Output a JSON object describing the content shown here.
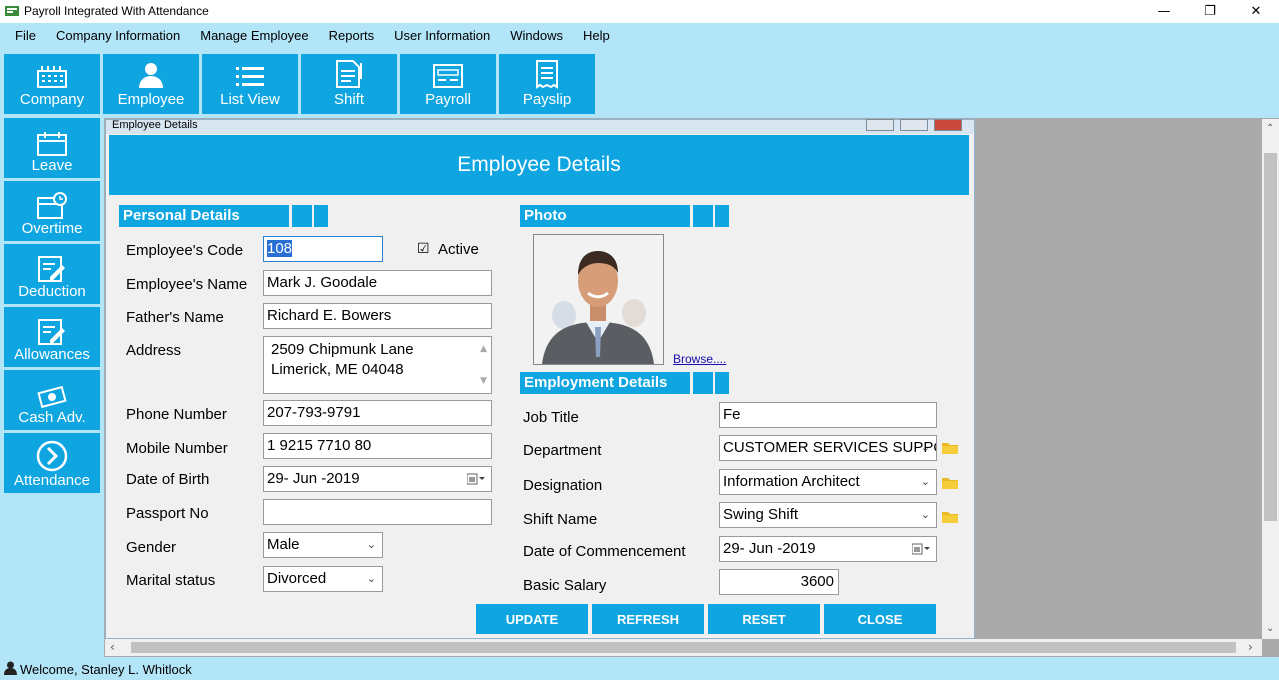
{
  "window": {
    "title": "Payroll Integrated With Attendance"
  },
  "menu": [
    "File",
    "Company Information",
    "Manage Employee",
    "Reports",
    "User Information",
    "Windows",
    "Help"
  ],
  "toolbar": {
    "company": "Company",
    "employee": "Employee",
    "listview": "List View",
    "shift": "Shift",
    "payroll": "Payroll",
    "payslip": "Payslip"
  },
  "sidebar": {
    "leave": "Leave",
    "overtime": "Overtime",
    "deduction": "Deduction",
    "allowances": "Allowances",
    "cashadv": "Cash Adv.",
    "attendance": "Attendance"
  },
  "child": {
    "title": "Employee Details",
    "header": "Employee Details"
  },
  "personal": {
    "section": "Personal Details",
    "code_label": "Employee's Code",
    "code": "108",
    "active_label": "Active",
    "name_label": "Employee's Name",
    "name": "Mark J. Goodale",
    "father_label": "Father's Name",
    "father": "Richard E. Bowers",
    "address_label": "Address",
    "address_line1": "2509 Chipmunk Lane",
    "address_line2": "Limerick, ME 04048",
    "phone_label": "Phone Number",
    "phone": "207-793-9791",
    "mobile_label": "Mobile Number",
    "mobile": "1 9215 7710 80",
    "dob_label": "Date of Birth",
    "dob": "29- Jun -2019",
    "passport_label": "Passport No",
    "passport": "",
    "gender_label": "Gender",
    "gender": "Male",
    "marital_label": "Marital status",
    "marital": "Divorced"
  },
  "photo": {
    "section": "Photo",
    "browse": "Browse...."
  },
  "employment": {
    "section": "Employment Details",
    "job_label": "Job Title",
    "job": "Fe",
    "dept_label": "Department",
    "dept": "CUSTOMER SERVICES SUPPORT",
    "desig_label": "Designation",
    "desig": "Information Architect",
    "shift_label": "Shift Name",
    "shift": "Swing Shift",
    "doc_label": "Date of Commencement",
    "doc": "29- Jun -2019",
    "salary_label": "Basic Salary",
    "salary": "3600"
  },
  "actions": {
    "update": "UPDATE",
    "refresh": "REFRESH",
    "reset": "RESET",
    "close": "CLOSE"
  },
  "status": {
    "welcome": "Welcome, Stanley L. Whitlock"
  },
  "colors": {
    "accent": "#0ea5e1",
    "panel_bg": "#b3e5f8",
    "mdi_bg": "#aaaaaa"
  }
}
